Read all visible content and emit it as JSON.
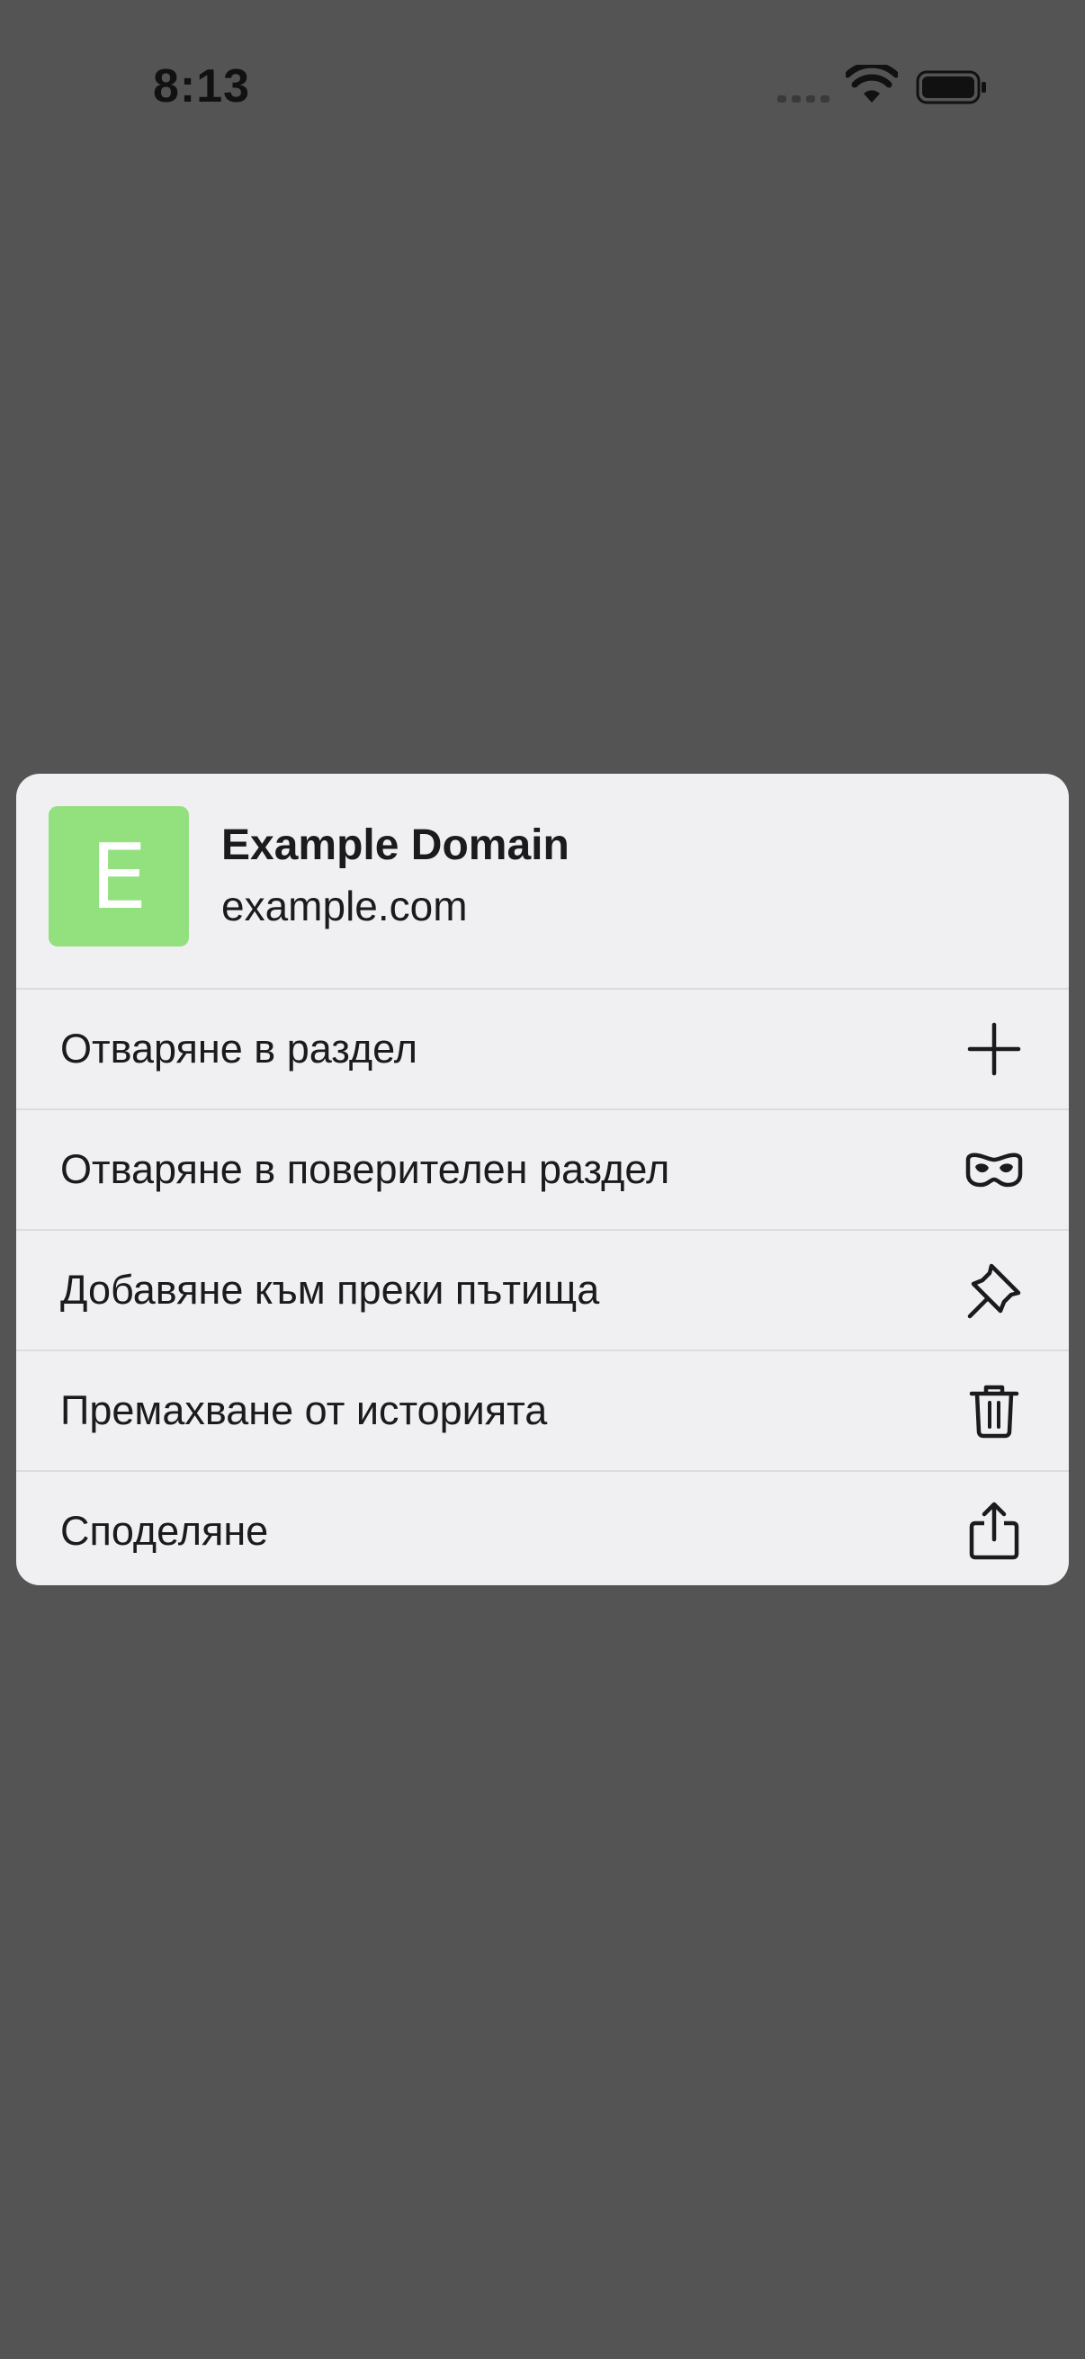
{
  "status_bar": {
    "time": "8:13"
  },
  "site": {
    "avatar_letter": "E",
    "title": "Example Domain",
    "url": "example.com"
  },
  "menu": {
    "items": [
      {
        "label": "Отваряне в раздел",
        "icon": "plus-icon"
      },
      {
        "label": "Отваряне в поверителен раздел",
        "icon": "incognito-mask-icon"
      },
      {
        "label": "Добавяне към преки пътища",
        "icon": "pin-icon"
      },
      {
        "label": "Премахване от историята",
        "icon": "trash-icon"
      },
      {
        "label": "Споделяне",
        "icon": "share-icon"
      }
    ]
  },
  "colors": {
    "background_dim": "#545454",
    "card_background": "#f0f0f2",
    "avatar_background": "#93e07f",
    "text_primary": "#1b1b1d"
  }
}
